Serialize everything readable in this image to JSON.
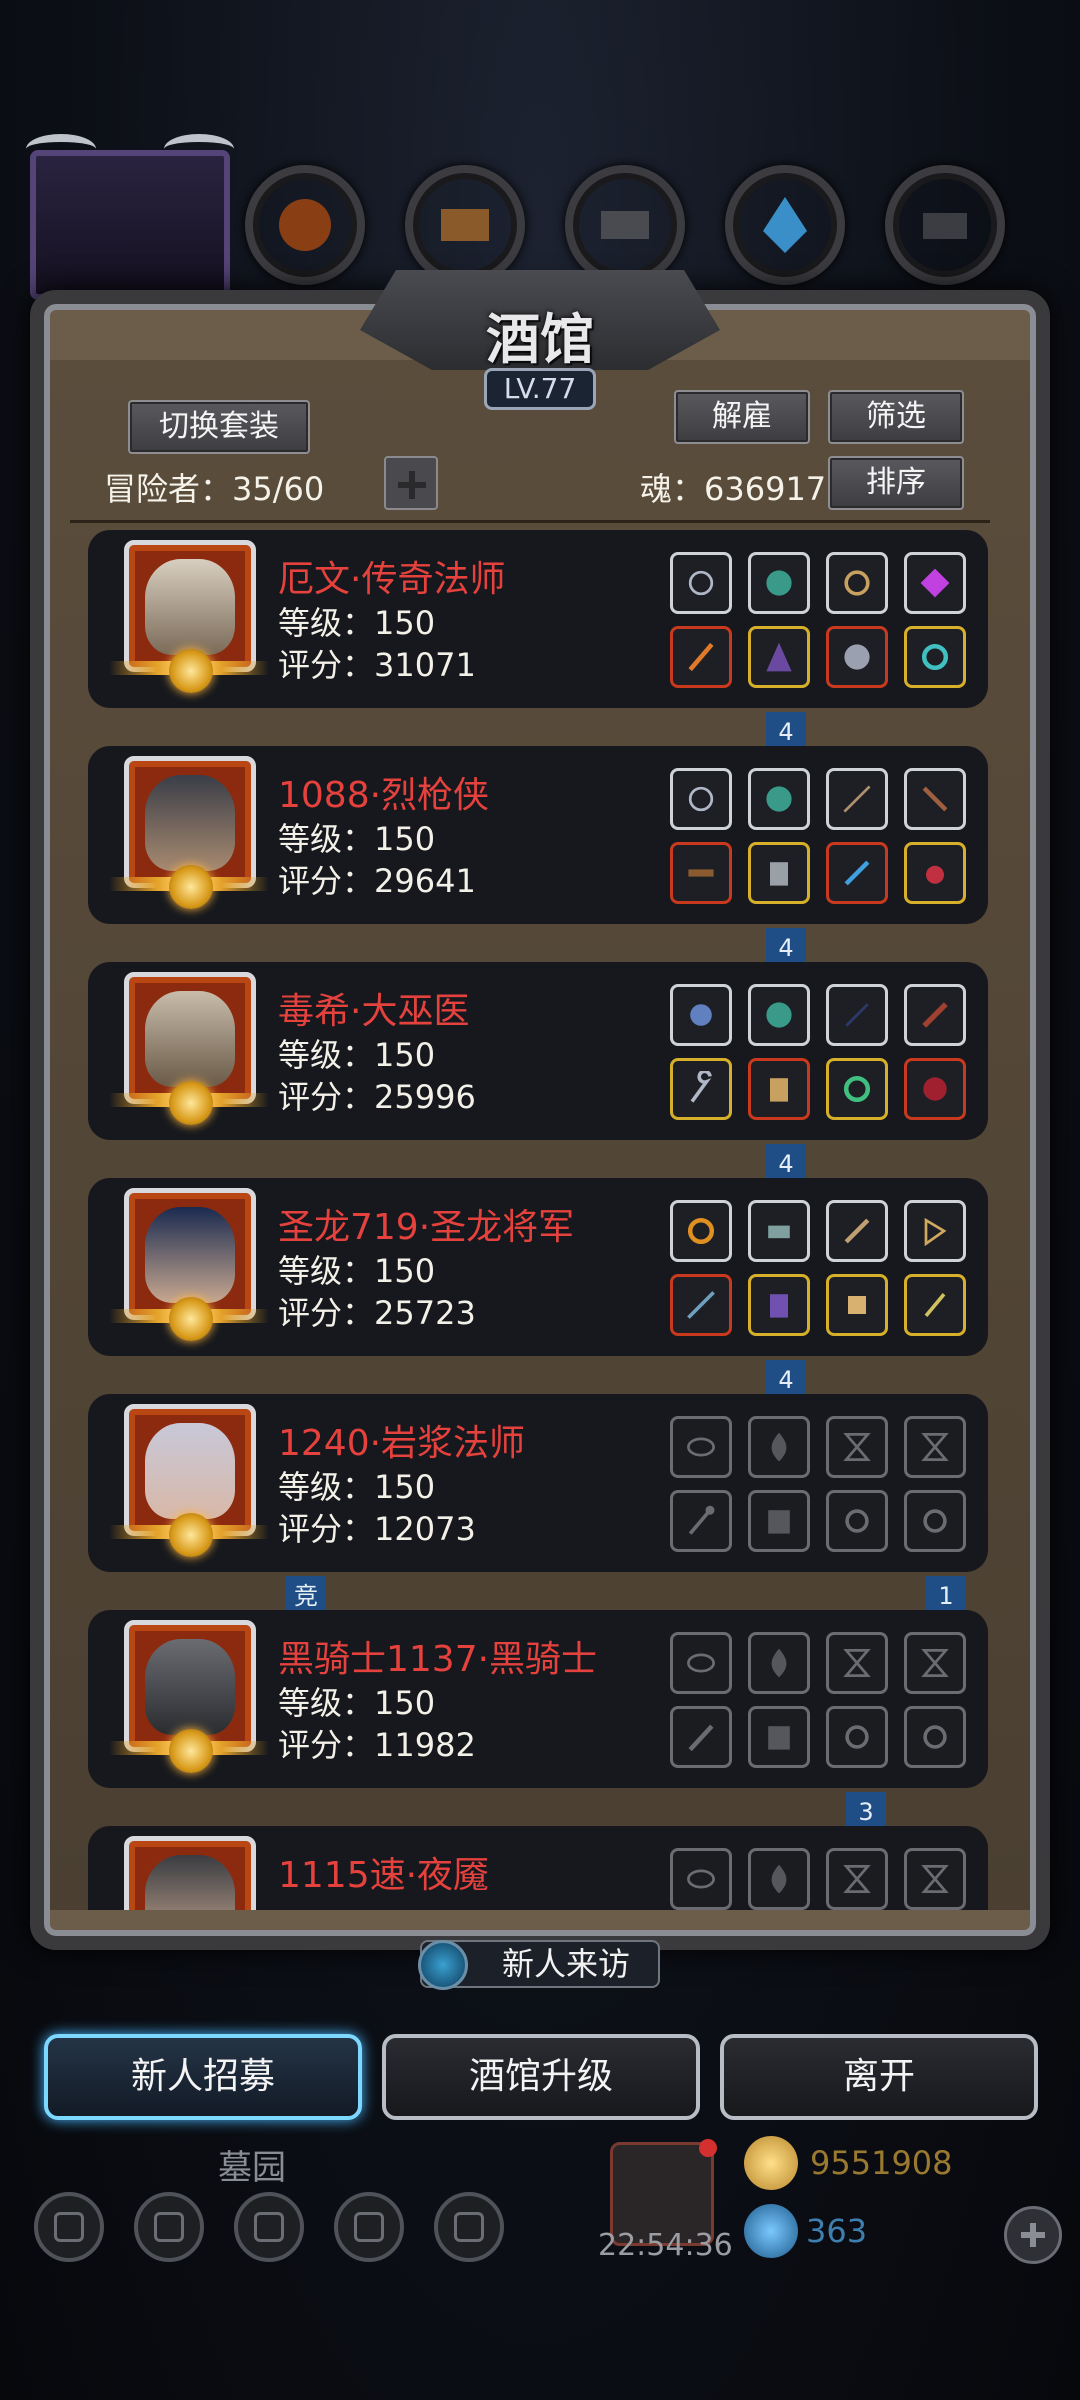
{
  "tavern": {
    "title": "酒馆",
    "level": "LV.77",
    "switch_outfit_label": "切换套装",
    "dismiss_label": "解雇",
    "filter_label": "筛选",
    "sort_label": "排序",
    "adventurers_label": "冒险者：35/60",
    "soul_label": "魂：636917"
  },
  "adventurers": [
    {
      "name": "厄文·传奇法师",
      "level": "等级：150",
      "score": "评分：31071",
      "tag": "4"
    },
    {
      "name": "1088·烈枪侠",
      "level": "等级：150",
      "score": "评分：29641",
      "tag": "4"
    },
    {
      "name": "毒希·大巫医",
      "level": "等级：150",
      "score": "评分：25996",
      "tag": "4"
    },
    {
      "name": "圣龙719·圣龙将军",
      "level": "等级：150",
      "score": "评分：25723",
      "tag": "4"
    },
    {
      "name": "1240·岩浆法师",
      "level": "等级：150",
      "score": "评分：12073",
      "tag_left": "竞",
      "tag": "1"
    },
    {
      "name": "黑骑士1137·黑骑士",
      "level": "等级：150",
      "score": "评分：11982",
      "tag": "3"
    },
    {
      "name": "1115速·夜魇"
    }
  ],
  "bottom": {
    "visit_label": "新人来访",
    "recruit_label": "新人招募",
    "upgrade_label": "酒馆升级",
    "leave_label": "离开",
    "cemetery_label": "墓园",
    "timer": "22:54:36",
    "gold": "9551908",
    "gems": "363"
  },
  "colors": {
    "name_red": "#e5413d",
    "tag_blue": "#1f4e86",
    "active_glow": "#7dd8ff"
  }
}
